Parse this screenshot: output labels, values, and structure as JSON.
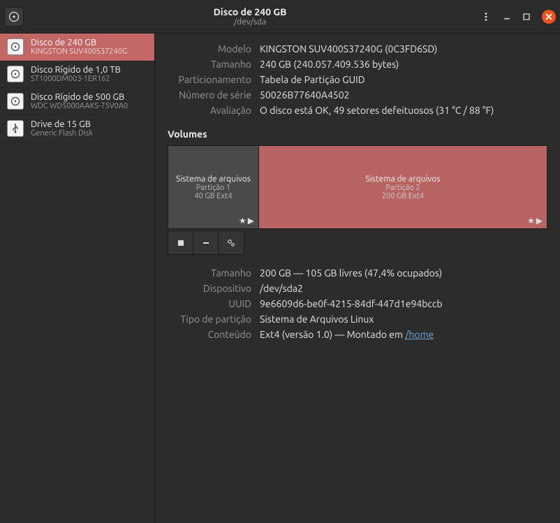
{
  "header": {
    "title": "Disco de 240 GB",
    "subtitle": "/dev/sda"
  },
  "sidebar": {
    "items": [
      {
        "title": "Disco de 240 GB",
        "sub": "KINGSTON SUV400S37240G",
        "icon": "hdd"
      },
      {
        "title": "Disco Rígido de 1,0 TB",
        "sub": "ST1000DM003-1ER162",
        "icon": "hdd"
      },
      {
        "title": "Disco Rígido de 500 GB",
        "sub": "WDC WD5000AAKS-75V0A0",
        "icon": "hdd"
      },
      {
        "title": "Drive de 15 GB",
        "sub": "Generic Flash Disk",
        "icon": "usb"
      }
    ]
  },
  "drive": {
    "labels": {
      "model": "Modelo",
      "size": "Tamanho",
      "partitioning": "Particionamento",
      "serial": "Número de série",
      "assessment": "Avaliação"
    },
    "model": "KINGSTON SUV400S37240G (0C3FD6SD)",
    "size": "240 GB (240.057.409.536 bytes)",
    "partitioning": "Tabela de Partição GUID",
    "serial": "50026B77640A4502",
    "assessment": "O disco está OK, 49 setores defeituosos (31 °C / 88 °F)"
  },
  "volumes": {
    "title": "Volumes",
    "list": [
      {
        "name": "Sistema de arquivos",
        "part": "Partição 1",
        "size": "40 GB Ext4",
        "flex": "0 0 130px",
        "selected": false
      },
      {
        "name": "Sistema de arquivos",
        "part": "Partição 2",
        "size": "200 GB Ext4",
        "flex": "1",
        "selected": true
      }
    ]
  },
  "partition": {
    "labels": {
      "size": "Tamanho",
      "device": "Dispositivo",
      "uuid": "UUID",
      "ptype": "Tipo de partição",
      "contents": "Conteúdo"
    },
    "size": "200 GB — 105 GB livres (47,4% ocupados)",
    "device": "/dev/sda2",
    "uuid": "9e6609d6-be0f-4215-84df-447d1e94bccb",
    "ptype": "Sistema de Arquivos Linux",
    "contents_prefix": "Ext4 (versão 1.0) — Montado em ",
    "mount": "/home"
  }
}
